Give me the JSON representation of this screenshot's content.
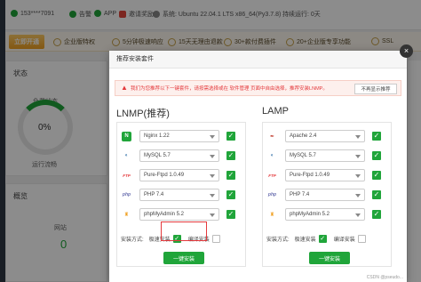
{
  "topbar": {
    "user": "153****7091",
    "alerts": "告警",
    "app": "APP",
    "redeem": "邀请奖励",
    "os": "系统: Ubuntu 22.04.1 LTS x86_64(Py3.7.8)",
    "uptime": "持续运行: 0天"
  },
  "banner": {
    "buy_label": "立即开通",
    "features": [
      "企业版特权",
      "5分钟极速响应",
      "15天无理由退款",
      "30+款付费插件",
      "20+企业版专享功能",
      "SSL"
    ]
  },
  "status_card": {
    "title": "状态",
    "subtitle": "负载状态",
    "value": "0%",
    "caption": "运行流畅"
  },
  "overview_card": {
    "title": "概览",
    "sites_label": "网站",
    "sites_count": "0"
  },
  "modal": {
    "title": "推荐安装套件",
    "close": "×",
    "notice": "我们为您推荐以下一键套件，请按需选择或在 软件管理 页面中自由选择，推荐安装LNMP。",
    "notice_button": "不再显示推荐",
    "install_method_label": "安装方式:",
    "fast_label": "极速安装",
    "compile_label": "编译安装",
    "install_button": "一键安装",
    "lnmp": {
      "title": "LNMP(推荐)",
      "items": [
        {
          "logo": "N",
          "name": "Nginx 1.22",
          "checked": true
        },
        {
          "logo": "◐",
          "name": "MySQL 5.7",
          "checked": true
        },
        {
          "logo": "FTP",
          "name": "Pure-Ftpd 1.0.49",
          "checked": true
        },
        {
          "logo": "php",
          "name": "PHP 7.4",
          "checked": true
        },
        {
          "logo": "♜",
          "name": "phpMyAdmin 5.2",
          "checked": true
        }
      ]
    },
    "lamp": {
      "title": "LAMP",
      "items": [
        {
          "logo": "✒",
          "name": "Apache 2.4",
          "checked": true
        },
        {
          "logo": "◐",
          "name": "MySQL 5.7",
          "checked": true
        },
        {
          "logo": "FTP",
          "name": "Pure-Ftpd 1.0.49",
          "checked": true
        },
        {
          "logo": "php",
          "name": "PHP 7.4",
          "checked": true
        },
        {
          "logo": "♜",
          "name": "phpMyAdmin 5.2",
          "checked": true
        }
      ]
    }
  },
  "watermark": "CSDN @pseudo...",
  "colors": {
    "accent": "#20a53a",
    "danger": "#e4393c"
  }
}
